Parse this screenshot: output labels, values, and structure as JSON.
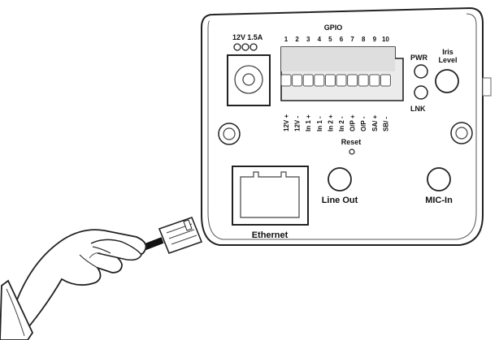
{
  "panel": {
    "power_label": "12V 1.5A",
    "gpio_title": "GPIO",
    "gpio_numbers": [
      "1",
      "2",
      "3",
      "4",
      "5",
      "6",
      "7",
      "8",
      "9",
      "10"
    ],
    "gpio_pins": [
      "12V +",
      "12V -",
      "In 1 +",
      "In 1 -",
      "In 2 +",
      "In 2 -",
      "O/P +",
      "O/P -",
      "SA/ +",
      "SB/ -"
    ],
    "pwr_label": "PWR",
    "lnk_label": "LNK",
    "iris_label_line1": "Iris",
    "iris_label_line2": "Level",
    "reset_label": "Reset",
    "ethernet_label": "Ethernet",
    "line_out_label": "Line Out",
    "mic_in_label": "MIC-In"
  },
  "colors": {
    "stroke": "#222222",
    "panel_fill": "#ffffff",
    "terminal_fill": "#e6e6e6",
    "skin": "#ffffff"
  }
}
